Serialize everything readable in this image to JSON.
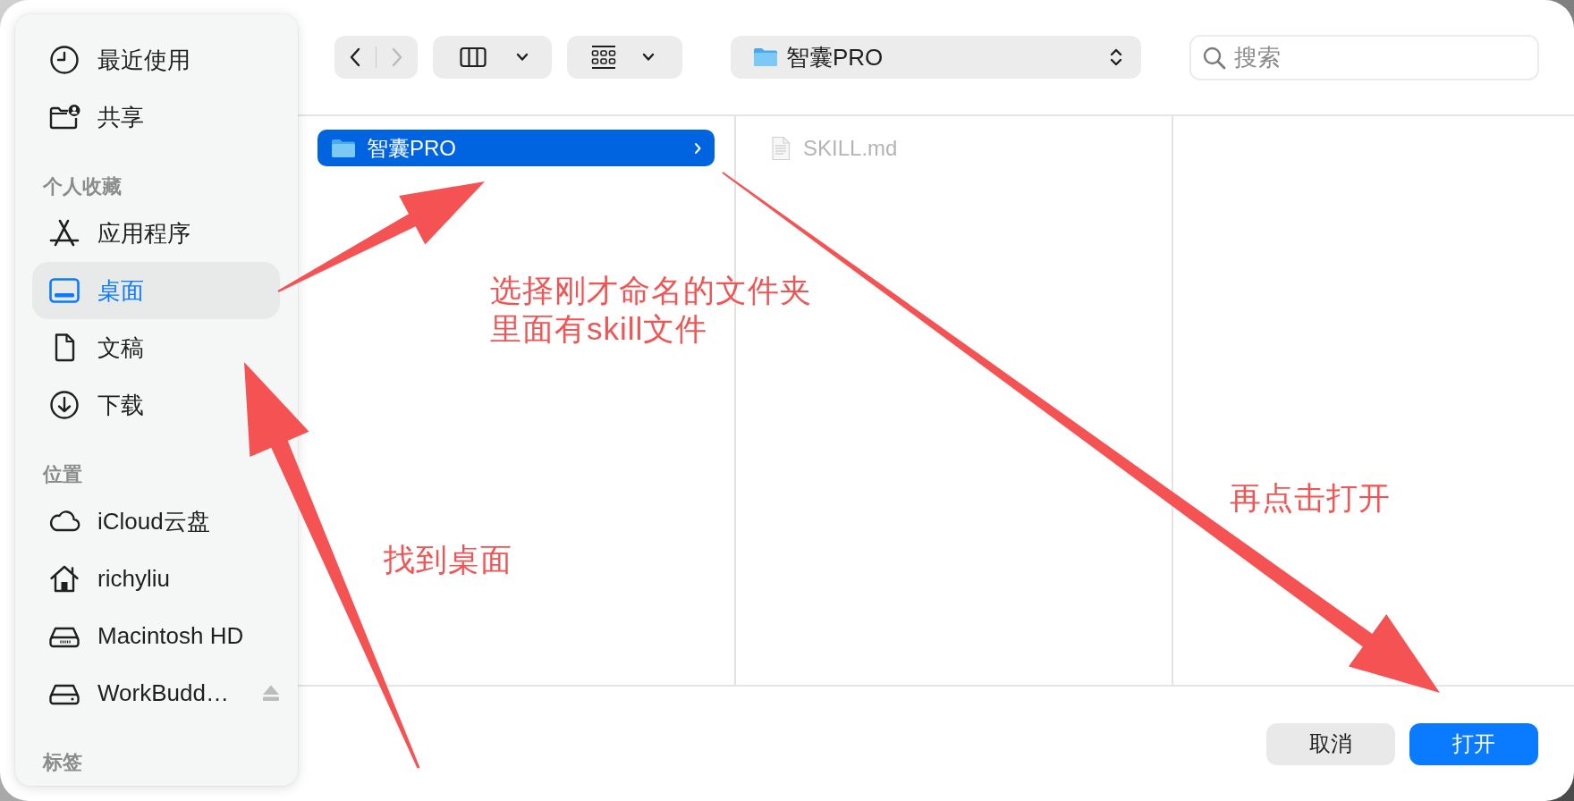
{
  "sidebar": {
    "sections": [
      {
        "items": [
          {
            "label": "最近使用",
            "kind": "recents",
            "selected": false
          },
          {
            "label": "共享",
            "kind": "shared",
            "selected": false
          }
        ]
      },
      {
        "header": "个人收藏",
        "items": [
          {
            "label": "应用程序",
            "kind": "applications",
            "selected": false
          },
          {
            "label": "桌面",
            "kind": "desktop",
            "selected": true
          },
          {
            "label": "文稿",
            "kind": "documents",
            "selected": false
          },
          {
            "label": "下载",
            "kind": "downloads",
            "selected": false
          }
        ]
      },
      {
        "header": "位置",
        "items": [
          {
            "label": "iCloud云盘",
            "kind": "cloud",
            "selected": false
          },
          {
            "label": "richyliu",
            "kind": "home",
            "selected": false
          },
          {
            "label": "Macintosh HD",
            "kind": "startup-disk",
            "selected": false
          },
          {
            "label": "WorkBudd…",
            "kind": "external-disk",
            "selected": false
          }
        ]
      },
      {
        "header": "标签"
      }
    ]
  },
  "toolbar": {
    "back": {
      "disabled": false
    },
    "forward": {
      "disabled": true
    },
    "path": "智囊PRO",
    "search": {
      "placeholder": "搜索"
    }
  },
  "browser": {
    "columns": [
      {
        "items": [
          {
            "name": "智囊PRO",
            "kind": "folder",
            "selected": true,
            "disabled": false
          }
        ]
      },
      {
        "items": [
          {
            "name": "SKILL.md",
            "kind": "file",
            "selected": false,
            "disabled": true
          }
        ]
      }
    ]
  },
  "buttons": [
    {
      "label": "取消",
      "kind": "secondary"
    },
    {
      "label": "打开",
      "kind": "primary"
    }
  ],
  "annotations": [
    {
      "lines": [
        "选择刚才命名的文件夹",
        "里面有skill文件"
      ]
    },
    {
      "lines": [
        "找到桌面"
      ]
    },
    {
      "lines": [
        "再点击打开"
      ]
    }
  ]
}
